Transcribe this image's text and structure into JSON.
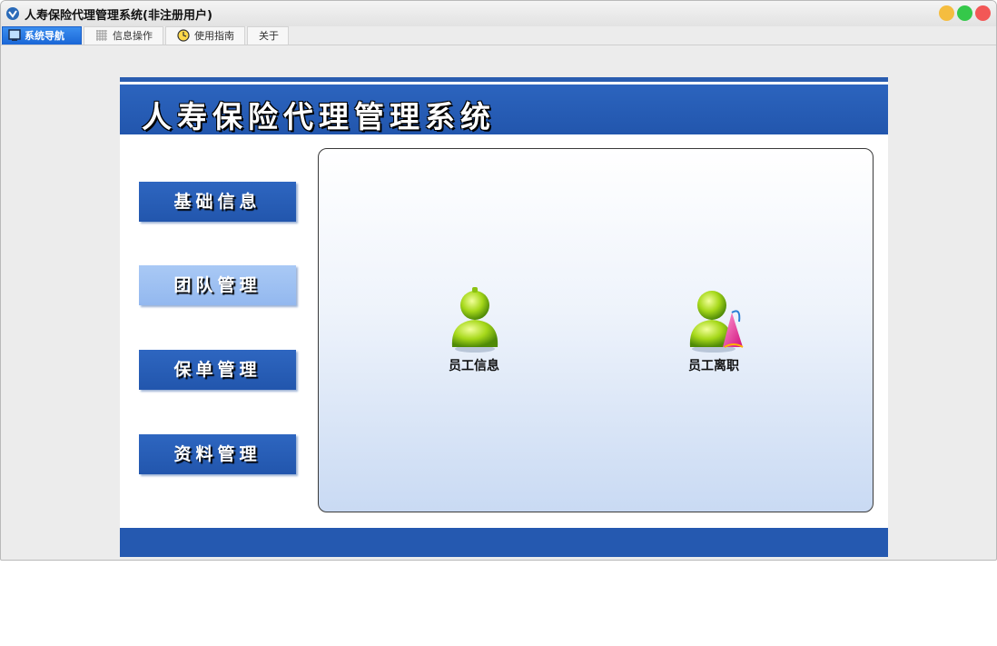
{
  "window": {
    "title": "人寿保险代理管理系统(非注册用户)"
  },
  "tabs": [
    {
      "label": "系统导航",
      "icon": "monitor-icon",
      "active": true
    },
    {
      "label": "信息操作",
      "icon": "grid-icon",
      "active": false
    },
    {
      "label": "使用指南",
      "icon": "clock-icon",
      "active": false
    },
    {
      "label": "关于",
      "icon": "",
      "active": false
    }
  ],
  "header": {
    "title": "人寿保险代理管理系统"
  },
  "nav": [
    {
      "label": "基础信息",
      "selected": false
    },
    {
      "label": "团队管理",
      "selected": true
    },
    {
      "label": "保单管理",
      "selected": false
    },
    {
      "label": "资料管理",
      "selected": false
    }
  ],
  "content": {
    "items": [
      {
        "label": "员工信息",
        "icon": "employee-user-icon"
      },
      {
        "label": "员工离职",
        "icon": "employee-leave-icon"
      }
    ]
  },
  "colors": {
    "brand_blue": "#2559b0",
    "selected_nav": "#a9c9f5",
    "active_tab": "#1a66d6",
    "traffic_min": "#f5bd3f",
    "traffic_max": "#35c84a",
    "traffic_close": "#f25756"
  }
}
